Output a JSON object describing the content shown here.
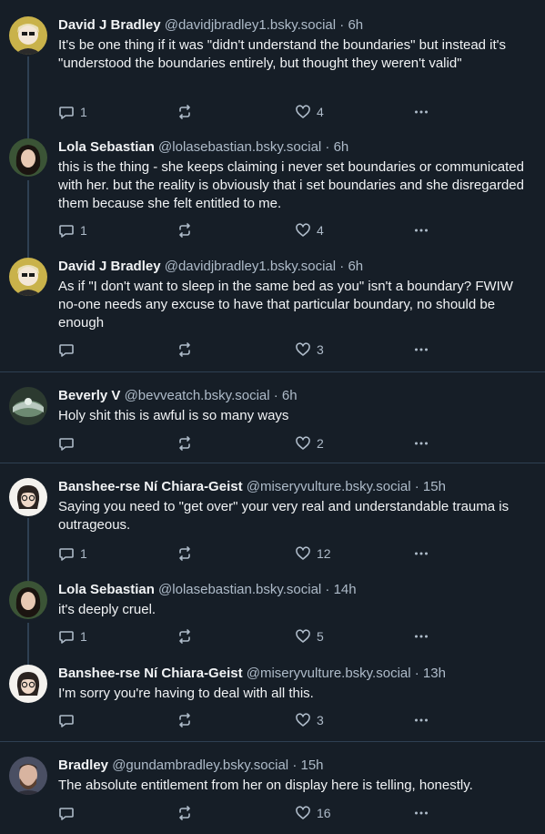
{
  "posts": [
    {
      "name": "David J Bradley",
      "handle": "@davidjbradley1.bsky.social",
      "time": "· 6h",
      "text": "It's be one thing if it was \"didn't understand the boundaries\" but instead it's \"understood the boundaries entirely, but thought they weren't valid\"",
      "replies": "1",
      "reposts": "",
      "likes": "4"
    },
    {
      "name": "Lola Sebastian",
      "handle": "@lolasebastian.bsky.social",
      "time": "· 6h",
      "text": "this is the thing - she keeps claiming i never set boundaries or communicated with her. but the reality is obviously that i set boundaries and she disregarded them because she felt entitled to me.",
      "replies": "1",
      "reposts": "",
      "likes": "4"
    },
    {
      "name": "David J Bradley",
      "handle": "@davidjbradley1.bsky.social",
      "time": "· 6h",
      "text": "As if \"I don't want to sleep in the same bed as you\" isn't a boundary? FWIW no-one needs any excuse to have that particular boundary, no should be enough",
      "replies": "",
      "reposts": "",
      "likes": "3"
    },
    {
      "name": "Beverly V",
      "handle": "@bevveatch.bsky.social",
      "time": "· 6h",
      "text": "Holy shit this is awful is so many ways",
      "replies": "",
      "reposts": "",
      "likes": "2"
    },
    {
      "name": "Banshee-rse Ní Chiara-Geist",
      "handle": "@miseryvulture.bsky.social",
      "time": "· 15h",
      "text": "Saying you need to \"get over\" your very real and understandable trauma is outrageous.",
      "replies": "1",
      "reposts": "",
      "likes": "12"
    },
    {
      "name": "Lola Sebastian",
      "handle": "@lolasebastian.bsky.social",
      "time": "· 14h",
      "text": "it's deeply cruel.",
      "replies": "1",
      "reposts": "",
      "likes": "5"
    },
    {
      "name": "Banshee-rse Ní Chiara-Geist",
      "handle": "@miseryvulture.bsky.social",
      "time": "· 13h",
      "text": "I'm sorry you're having to deal with all this.",
      "replies": "",
      "reposts": "",
      "likes": "3"
    },
    {
      "name": "Bradley",
      "handle": "@gundambradley.bsky.social",
      "time": "· 15h",
      "text": "The absolute entitlement from her on display here is telling, honestly.",
      "replies": "",
      "reposts": "",
      "likes": "16"
    }
  ],
  "icons": {
    "reply": "reply-icon",
    "repost": "repost-icon",
    "like": "heart-icon",
    "more": "more-options-icon"
  },
  "colors": {
    "background": "#161e27",
    "text": "#f1f3f5",
    "muted": "#aebbc9",
    "divider": "#2e4052"
  }
}
